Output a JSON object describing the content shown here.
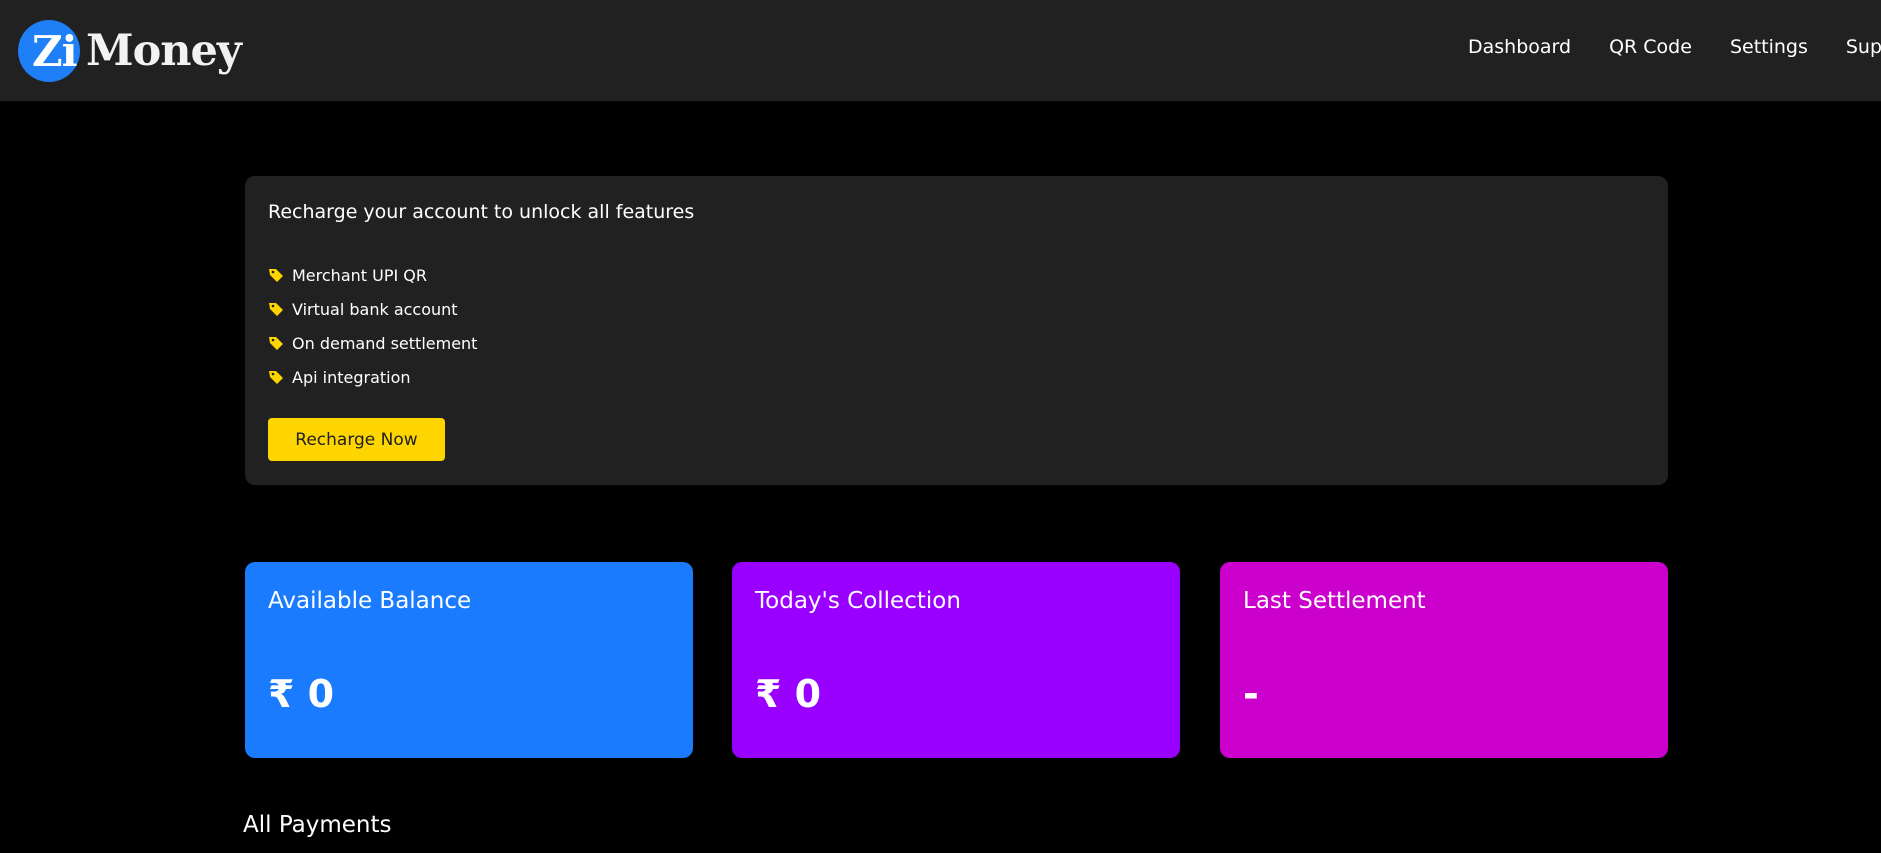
{
  "header": {
    "logo_badge": "Zi",
    "logo_word": "Money",
    "nav": [
      "Dashboard",
      "QR Code",
      "Settings",
      "Support"
    ]
  },
  "promo": {
    "title": "Recharge your account to unlock all features",
    "features": [
      "Merchant UPI QR",
      "Virtual bank account",
      "On demand settlement",
      "Api integration"
    ],
    "feature_icon": "tag-icon",
    "button_label": "Recharge Now"
  },
  "cards": [
    {
      "title": "Available Balance",
      "value": "₹ 0",
      "color": "#1a7bff"
    },
    {
      "title": "Today's Collection",
      "value": "₹ 0",
      "color": "#9900ff"
    },
    {
      "title": "Last Settlement",
      "value": "-",
      "color": "#cc00cc"
    }
  ],
  "sections": {
    "payments_title": "All Payments"
  },
  "colors": {
    "topbar": "#212121",
    "accent_yellow": "#ffd500",
    "logo_blue": "#1e7ff6"
  }
}
